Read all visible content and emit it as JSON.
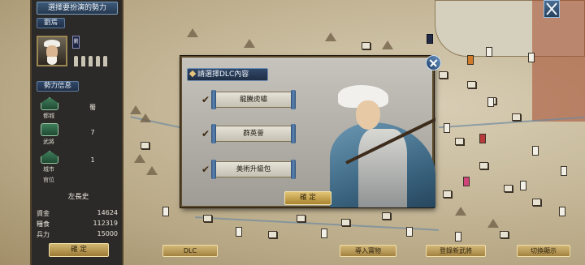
{
  "left_panel": {
    "title": "選擇要扮演的勢力",
    "ruler_label": "劉焉",
    "faction_tag": "劉",
    "info_label": "勢力信息",
    "stats": [
      {
        "caption": "都城",
        "value": "蜀"
      },
      {
        "caption": "武將",
        "value": "7"
      },
      {
        "caption": "城市",
        "value": "1"
      }
    ],
    "rank_caption": "官位",
    "rank_value": "左長史",
    "resources": [
      {
        "label": "資金",
        "value": "14624"
      },
      {
        "label": "糧食",
        "value": "112319"
      },
      {
        "label": "兵力",
        "value": "15000"
      }
    ],
    "confirm_label": "確 定"
  },
  "bottom_bar": {
    "dlc": "DLC",
    "import_item": "導入寶物",
    "register_general": "登錄新武將",
    "switch_display": "切換顯示"
  },
  "dlc_dialog": {
    "title": "請選擇DLC內容",
    "options": [
      {
        "label": "龍騰虎嘯",
        "checked": true
      },
      {
        "label": "群英薈",
        "checked": true
      },
      {
        "label": "美術升級包",
        "checked": true
      }
    ],
    "confirm_label": "確 定"
  },
  "icons": {
    "close": "close-icon",
    "corner": "crossed-swords-icon",
    "check": "check-icon"
  },
  "colors": {
    "accent_blue": "#32496a",
    "gold_button": "#d2b873",
    "panel_bg": "#2b2a28"
  }
}
